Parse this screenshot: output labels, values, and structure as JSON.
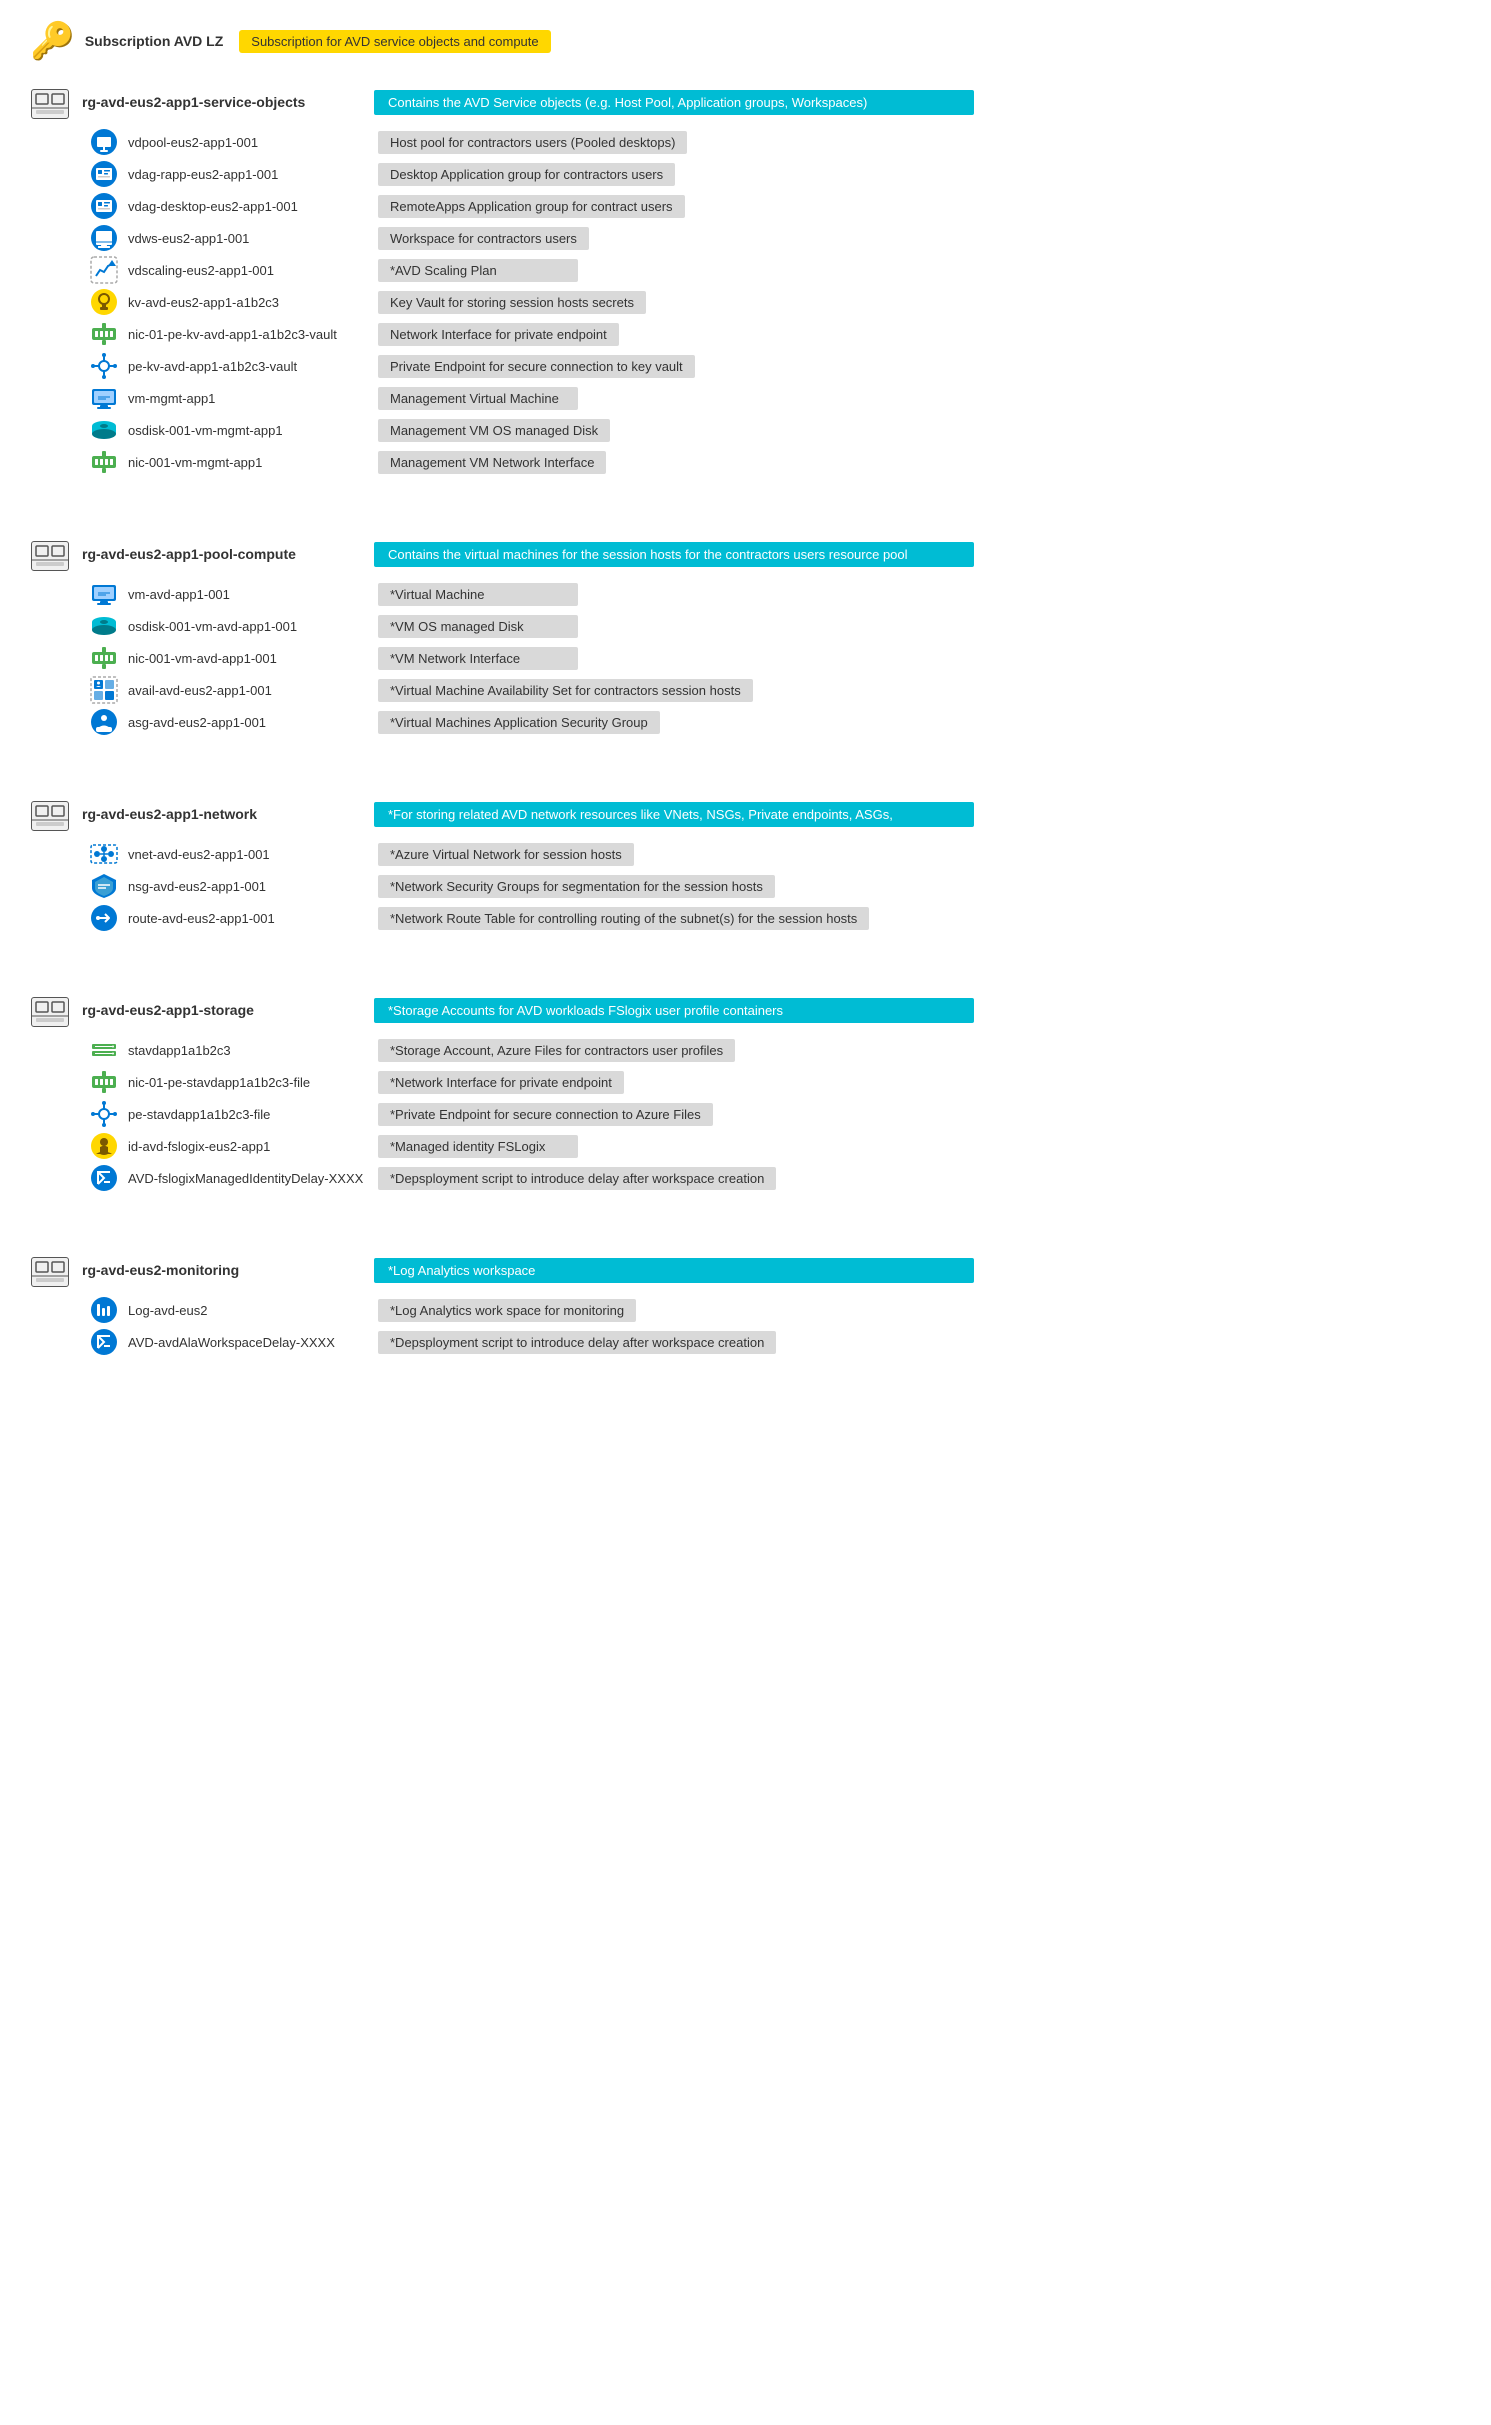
{
  "subscription": {
    "icon": "🔑",
    "label": "Subscription AVD LZ",
    "badge": "Subscription for AVD service objects and compute"
  },
  "resourceGroups": [
    {
      "id": "rg1",
      "name": "rg-avd-eus2-app1-service-objects",
      "desc": "Contains the AVD Service objects (e.g. Host Pool, Application groups, Workspaces)",
      "desc_color": "cyan",
      "resources": [
        {
          "name": "vdpool-eus2-app1-001",
          "desc": "Host pool for contractors users (Pooled desktops)",
          "icon": "hostpool"
        },
        {
          "name": "vdag-rapp-eus2-app1-001",
          "desc": "Desktop Application group for contractors users",
          "icon": "appgroup"
        },
        {
          "name": "vdag-desktop-eus2-app1-001",
          "desc": "RemoteApps Application group for contract users",
          "icon": "appgroup"
        },
        {
          "name": "vdws-eus2-app1-001",
          "desc": "Workspace for contractors users",
          "icon": "workspace"
        },
        {
          "name": "vdscaling-eus2-app1-001",
          "desc": "*AVD Scaling Plan",
          "icon": "scaling"
        },
        {
          "name": "kv-avd-eus2-app1-a1b2c3",
          "desc": "Key Vault for storing session hosts secrets",
          "icon": "keyvault"
        },
        {
          "name": "nic-01-pe-kv-avd-app1-a1b2c3-vault",
          "desc": "Network Interface for private endpoint",
          "icon": "nic"
        },
        {
          "name": "pe-kv-avd-app1-a1b2c3-vault",
          "desc": "Private Endpoint for secure connection to key vault",
          "icon": "endpoint"
        },
        {
          "name": "vm-mgmt-app1",
          "desc": "Management Virtual Machine",
          "icon": "vm"
        },
        {
          "name": "osdisk-001-vm-mgmt-app1",
          "desc": "Management VM OS managed Disk",
          "icon": "disk"
        },
        {
          "name": "nic-001-vm-mgmt-app1",
          "desc": "Management VM Network Interface",
          "icon": "nic"
        }
      ]
    },
    {
      "id": "rg2",
      "name": "rg-avd-eus2-app1-pool-compute",
      "desc": "Contains the virtual machines for the session hosts for the contractors users resource pool",
      "desc_color": "cyan",
      "resources": [
        {
          "name": "vm-avd-app1-001",
          "desc": "*Virtual Machine",
          "icon": "vm"
        },
        {
          "name": "osdisk-001-vm-avd-app1-001",
          "desc": "*VM OS managed Disk",
          "icon": "disk"
        },
        {
          "name": "nic-001-vm-avd-app1-001",
          "desc": "*VM Network Interface",
          "icon": "nic"
        },
        {
          "name": "avail-avd-eus2-app1-001",
          "desc": "*Virtual Machine Availability Set for contractors session hosts",
          "icon": "availset"
        },
        {
          "name": "asg-avd-eus2-app1-001",
          "desc": "*Virtual Machines Application Security Group",
          "icon": "asg"
        }
      ]
    },
    {
      "id": "rg3",
      "name": "rg-avd-eus2-app1-network",
      "desc": "*For storing related AVD network resources like VNets, NSGs, Private endpoints, ASGs,",
      "desc_color": "cyan",
      "resources": [
        {
          "name": "vnet-avd-eus2-app1-001",
          "desc": "*Azure Virtual Network for session hosts",
          "icon": "vnet"
        },
        {
          "name": "nsg-avd-eus2-app1-001",
          "desc": "*Network Security Groups for segmentation for the session hosts",
          "icon": "nsg"
        },
        {
          "name": "route-avd-eus2-app1-001",
          "desc": "*Network Route Table for controlling routing of the subnet(s) for the session hosts",
          "icon": "routetable"
        }
      ]
    },
    {
      "id": "rg4",
      "name": "rg-avd-eus2-app1-storage",
      "desc": "*Storage Accounts for AVD workloads FSlogix user profile containers",
      "desc_color": "cyan",
      "resources": [
        {
          "name": "stavdapp1a1b2c3",
          "desc": "*Storage Account, Azure Files for contractors user profiles",
          "icon": "storage"
        },
        {
          "name": "nic-01-pe-stavdapp1a1b2c3-file",
          "desc": "*Network Interface for private endpoint",
          "icon": "nic"
        },
        {
          "name": "pe-stavdapp1a1b2c3-file",
          "desc": "*Private Endpoint for secure connection to Azure Files",
          "icon": "endpoint"
        },
        {
          "name": "id-avd-fslogix-eus2-app1",
          "desc": "*Managed identity FSLogix",
          "icon": "identity"
        },
        {
          "name": "AVD-fslogixManagedIdentityDelay-XXXX",
          "desc": "*Depsployment script to introduce delay after workspace creation",
          "icon": "deployScript"
        }
      ]
    },
    {
      "id": "rg5",
      "name": "rg-avd-eus2-monitoring",
      "desc": "*Log Analytics workspace",
      "desc_color": "cyan",
      "resources": [
        {
          "name": "Log-avd-eus2",
          "desc": "*Log Analytics work space for monitoring",
          "icon": "loganalytics"
        },
        {
          "name": "AVD-avdAlaWorkspaceDelay-XXXX",
          "desc": "*Depsployment script to introduce delay after workspace creation",
          "icon": "deployScript"
        }
      ]
    }
  ]
}
